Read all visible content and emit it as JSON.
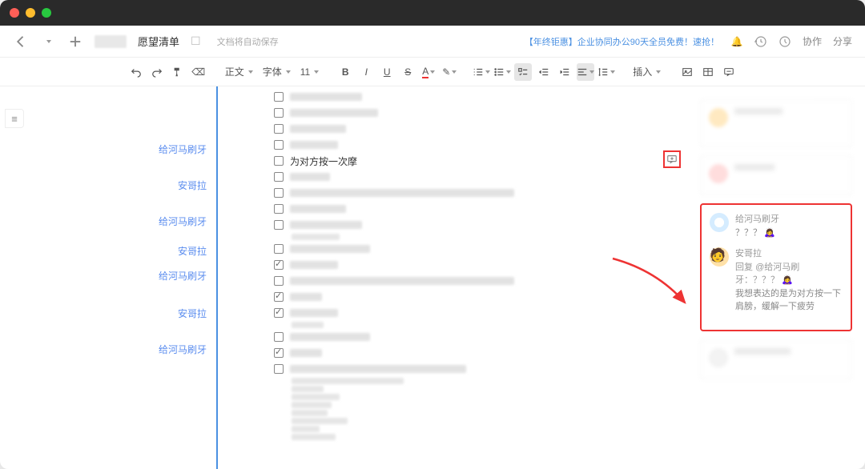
{
  "topbar": {
    "doc_title": "愿望清单",
    "autosave": "文档将自动保存",
    "promo": "【年终钜惠】企业协同办公90天全员免费！速抢！",
    "collab": "协作",
    "share": "分享"
  },
  "toolbar": {
    "style_label": "正文",
    "font_label": "字体",
    "font_size": "11",
    "insert_label": "插入"
  },
  "outline": {
    "items": [
      "给河马刷牙",
      "安哥拉",
      "给河马刷牙",
      "安哥拉",
      "给河马刷牙",
      "安哥拉",
      "给河马刷牙"
    ]
  },
  "tasks": {
    "visible_text": "为对方按一次摩"
  },
  "comments": {
    "thread": [
      {
        "name": "给河马刷牙",
        "text": "？？？",
        "emoji": "🙇‍♀️"
      },
      {
        "name": "安哥拉",
        "reply_to": "@给河马刷牙：？？？",
        "emoji": "🙇‍♀️",
        "text": "我想表达的是为对方按一下肩膀，缓解一下疲劳"
      }
    ]
  }
}
